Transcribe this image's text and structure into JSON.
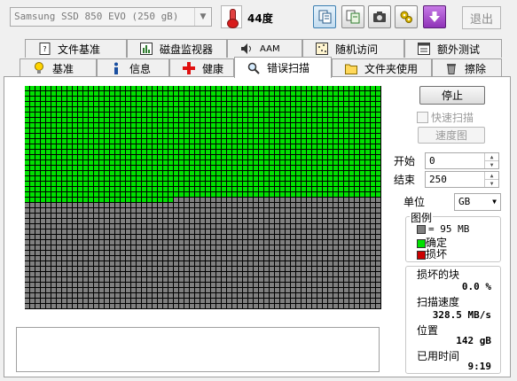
{
  "toolbar": {
    "drive": "Samsung SSD 850 EVO (250 gB)",
    "temperature": "44度",
    "exit_label": "退出"
  },
  "tabs_row1": [
    {
      "label": "文件基准",
      "icon": "document-icon"
    },
    {
      "label": "磁盘监视器",
      "icon": "monitor-chart-icon"
    },
    {
      "label": "AAM",
      "icon": "speaker-icon"
    },
    {
      "label": "随机访问",
      "icon": "random-access-icon"
    },
    {
      "label": "额外测试",
      "icon": "extra-tests-icon"
    }
  ],
  "tabs_row2": [
    {
      "label": "基准",
      "icon": "lightbulb-icon"
    },
    {
      "label": "信息",
      "icon": "info-icon"
    },
    {
      "label": "健康",
      "icon": "red-cross-icon"
    },
    {
      "label": "错误扫描",
      "icon": "magnifier-icon",
      "selected": true
    },
    {
      "label": "文件夹使用",
      "icon": "folder-icon"
    },
    {
      "label": "擦除",
      "icon": "trash-icon"
    }
  ],
  "scan": {
    "grid_columns": 67,
    "grid_rows": 42,
    "blocks_scanned": 1435,
    "block_colors": {
      "ok": "#00e100",
      "unscanned": "#808080",
      "damaged": "#cc0000"
    }
  },
  "controls": {
    "stop_label": "停止",
    "quick_scan_label": "快速扫描",
    "speed_map_label": "速度图",
    "start_label": "开始",
    "start_value": "0",
    "end_label": "结束",
    "end_value": "250",
    "unit_label": "单位",
    "unit_value": "GB"
  },
  "legend": {
    "title": "图例",
    "block_size": "= 95 MB",
    "ok_label": "确定",
    "damaged_label": "损坏"
  },
  "stats": {
    "damaged_blocks_label": "损坏的块",
    "damaged_blocks_value": "0.0 %",
    "speed_label": "扫描速度",
    "speed_value": "328.5 MB/s",
    "position_label": "位置",
    "position_value": "142 gB",
    "elapsed_label": "已用时间",
    "elapsed_value": "9:19"
  }
}
